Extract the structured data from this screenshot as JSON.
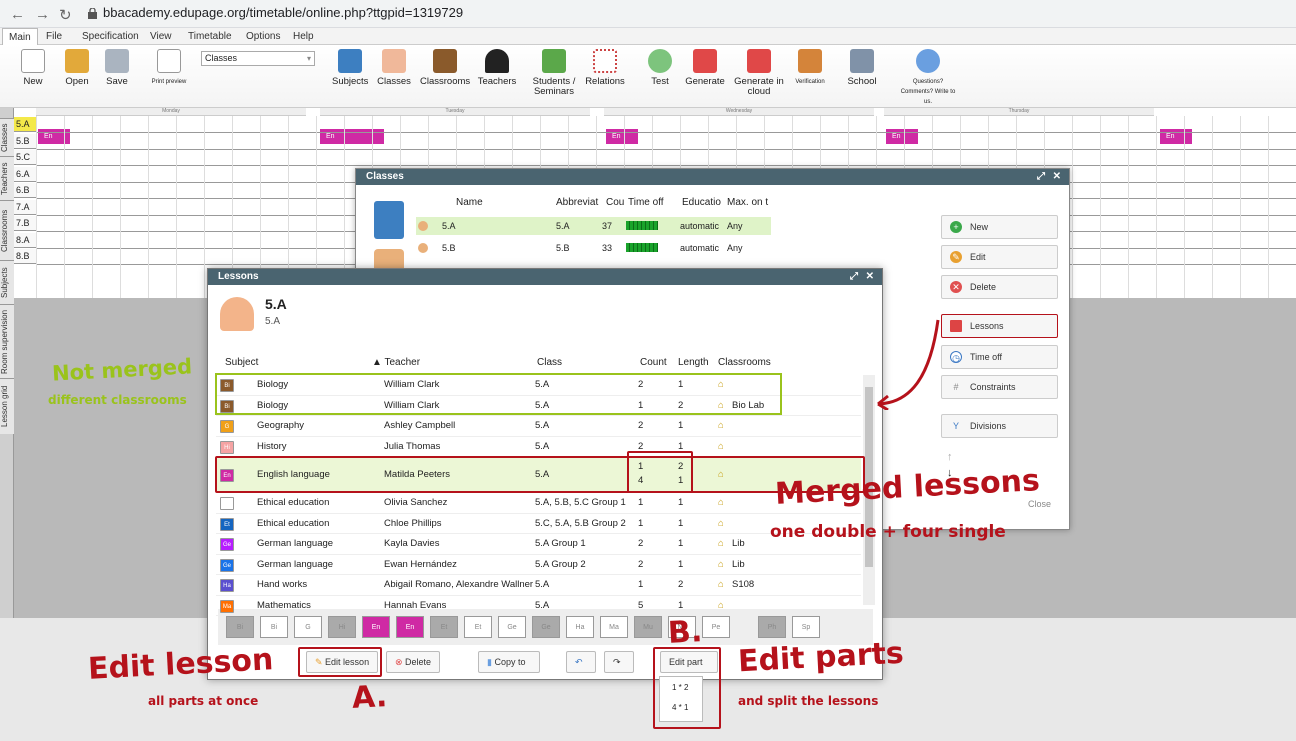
{
  "browser": {
    "url": "bbacademy.edupage.org/timetable/online.php?ttgpid=1319729"
  },
  "menu": [
    "Main",
    "File",
    "Specification",
    "View",
    "Timetable",
    "Options",
    "Help"
  ],
  "toolbar": {
    "new": "New",
    "open": "Open",
    "save": "Save",
    "print_preview": "Print preview",
    "class_select": "Classes",
    "subjects": "Subjects",
    "classes": "Classes",
    "classrooms": "Classrooms",
    "teachers": "Teachers",
    "students": "Students / Seminars",
    "relations": "Relations",
    "test": "Test",
    "generate": "Generate",
    "generate_cloud": "Generate in cloud",
    "verification": "Verification",
    "school": "School",
    "questions": "Questions? Comments? Write to us."
  },
  "grid": {
    "days": [
      "Monday",
      "Tuesday",
      "Wednesday",
      "Thursday"
    ],
    "rows": [
      "5.A",
      "5.B",
      "5.C",
      "6.A",
      "6.B",
      "7.A",
      "7.B",
      "8.A",
      "8.B"
    ],
    "cell_label": "En",
    "side_tabs": [
      "Classes",
      "Teachers",
      "Classrooms",
      "Subjects",
      "Room supervision",
      "Lesson grid"
    ]
  },
  "classes_dialog": {
    "title": "Classes",
    "headers": {
      "name": "Name",
      "abbr": "Abbreviat",
      "count": "Cou",
      "timeoff": "Time off",
      "edu": "Educatio",
      "max": "Max. on t"
    },
    "rows": [
      {
        "name": "5.A",
        "abbr": "5.A",
        "count": "37",
        "edu": "automatic",
        "max": "Any"
      },
      {
        "name": "5.B",
        "abbr": "5.B",
        "count": "33",
        "edu": "automatic",
        "max": "Any"
      }
    ],
    "buttons": {
      "new": "New",
      "edit": "Edit",
      "delete": "Delete",
      "lessons": "Lessons",
      "timeoff": "Time off",
      "constraints": "Constraints",
      "divisions": "Divisions",
      "close": "Close"
    }
  },
  "lessons_dialog": {
    "title": "Lessons",
    "class_name": "5.A",
    "class_sub": "5.A",
    "headers": {
      "subject": "Subject",
      "teacher": "▲ Teacher",
      "class": "Class",
      "count": "Count",
      "length": "Length",
      "classrooms": "Classrooms"
    },
    "rows": [
      {
        "abbr": "Bi",
        "subject": "Biology",
        "teacher": "William Clark",
        "class": "5.A",
        "count": "2",
        "length": "1",
        "rooms": "",
        "color": "#8b5a2b"
      },
      {
        "abbr": "Bi",
        "subject": "Biology",
        "teacher": "William Clark",
        "class": "5.A",
        "count": "1",
        "length": "2",
        "rooms": "Bio Lab",
        "color": "#8b5a2b"
      },
      {
        "abbr": "G",
        "subject": "Geography",
        "teacher": "Ashley Campbell",
        "class": "5.A",
        "count": "2",
        "length": "1",
        "rooms": "",
        "color": "#f0a018"
      },
      {
        "abbr": "Hi",
        "subject": "History",
        "teacher": "Julia Thomas",
        "class": "5.A",
        "count": "2",
        "length": "1",
        "rooms": "",
        "color": "#f5a3a3"
      },
      {
        "abbr": "En",
        "subject": "English language",
        "teacher": "Matilda Peeters",
        "class": "5.A",
        "count": "1",
        "length": "2",
        "count2": "4",
        "length2": "1",
        "rooms": "",
        "color": "#cf2aa4"
      },
      {
        "abbr": "Et",
        "subject": "Ethical education",
        "teacher": "Olivia Sanchez",
        "class": "5.A, 5.B, 5.C Group 1",
        "count": "1",
        "length": "1",
        "rooms": "",
        "color": "#ffffff"
      },
      {
        "abbr": "Et",
        "subject": "Ethical education",
        "teacher": "Chloe Phillips",
        "class": "5.C, 5.A, 5.B Group 2",
        "count": "1",
        "length": "1",
        "rooms": "",
        "color": "#1565c0"
      },
      {
        "abbr": "Ge",
        "subject": "German language",
        "teacher": "Kayla Davies",
        "class": "5.A Group 1",
        "count": "2",
        "length": "1",
        "rooms": "Lib",
        "color": "#b71cff"
      },
      {
        "abbr": "Ge",
        "subject": "German language",
        "teacher": "Ewan Hernández",
        "class": "5.A Group 2",
        "count": "2",
        "length": "1",
        "rooms": "Lib",
        "color": "#1a73e8"
      },
      {
        "abbr": "Ha",
        "subject": "Hand works",
        "teacher": "Abigail Romano, Alexandre Wallner",
        "class": "5.A",
        "count": "1",
        "length": "2",
        "rooms": "S108",
        "color": "#5a4fcf"
      },
      {
        "abbr": "Ma",
        "subject": "Mathematics",
        "teacher": "Hannah Evans",
        "class": "5.A",
        "count": "5",
        "length": "1",
        "rooms": "",
        "color": "#ff6f00"
      }
    ],
    "chips": [
      "Bi",
      "Bi",
      "G",
      "Hi",
      "En",
      "En",
      "Et",
      "Et",
      "Ge",
      "Ge",
      "Ha",
      "Ma",
      "Mu",
      "Na",
      "Pe",
      "Ph",
      "Sp"
    ],
    "buttons": {
      "edit_lesson": "Edit lesson",
      "delete": "Delete",
      "copy_to": "Copy to",
      "edit_part": "Edit part ▾",
      "part1": "1 * 2",
      "part2": "4 * 1"
    }
  },
  "annotations": {
    "not_merged": "Not merged",
    "different": "different classrooms",
    "merged": "Merged lessons",
    "merged_sub": "one double + four single",
    "edit_lesson": "Edit lesson",
    "edit_lesson_sub": "all parts at once",
    "a": "A.",
    "b": "B.",
    "edit_parts": "Edit parts",
    "edit_parts_sub": "and split the lessons"
  }
}
